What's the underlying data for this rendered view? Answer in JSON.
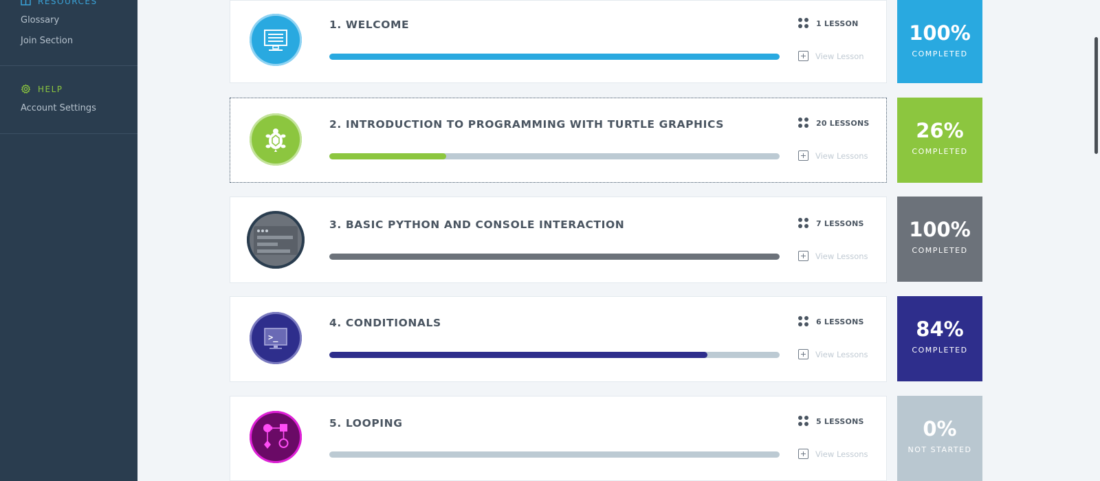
{
  "sidebar": {
    "resources_label": "RESOURCES",
    "resources_links": [
      "Glossary",
      "Join Section"
    ],
    "help_label": "HELP",
    "help_links": [
      "Account Settings"
    ],
    "resources_color": "#3aa3d8",
    "help_color": "#8cc63f"
  },
  "modules": [
    {
      "title": "1. WELCOME",
      "lessons": "1 LESSON",
      "view": "View Lesson",
      "percent": "100%",
      "status": "COMPLETED",
      "progress": 1.0,
      "color": "#29a9e0",
      "icon": "computer-monitor-icon"
    },
    {
      "title": "2. INTRODUCTION TO PROGRAMMING WITH TURTLE GRAPHICS",
      "lessons": "20 LESSONS",
      "view": "View Lessons",
      "percent": "26%",
      "status": "COMPLETED",
      "progress": 0.26,
      "color": "#8cc63f",
      "icon": "turtle-icon"
    },
    {
      "title": "3. BASIC PYTHON AND CONSOLE INTERACTION",
      "lessons": "7 LESSONS",
      "view": "View Lessons",
      "percent": "100%",
      "status": "COMPLETED",
      "progress": 1.0,
      "color": "#6c727a",
      "icon": "console-window-icon"
    },
    {
      "title": "4. CONDITIONALS",
      "lessons": "6 LESSONS",
      "view": "View Lessons",
      "percent": "84%",
      "status": "COMPLETED",
      "progress": 0.84,
      "color": "#2e2e8c",
      "icon": "terminal-prompt-icon"
    },
    {
      "title": "5. LOOPING",
      "lessons": "5 LESSONS",
      "view": "View Lessons",
      "percent": "0%",
      "status": "NOT STARTED",
      "progress": 0.0,
      "color": "#b9c7d0",
      "icon": "flowchart-icon"
    }
  ]
}
